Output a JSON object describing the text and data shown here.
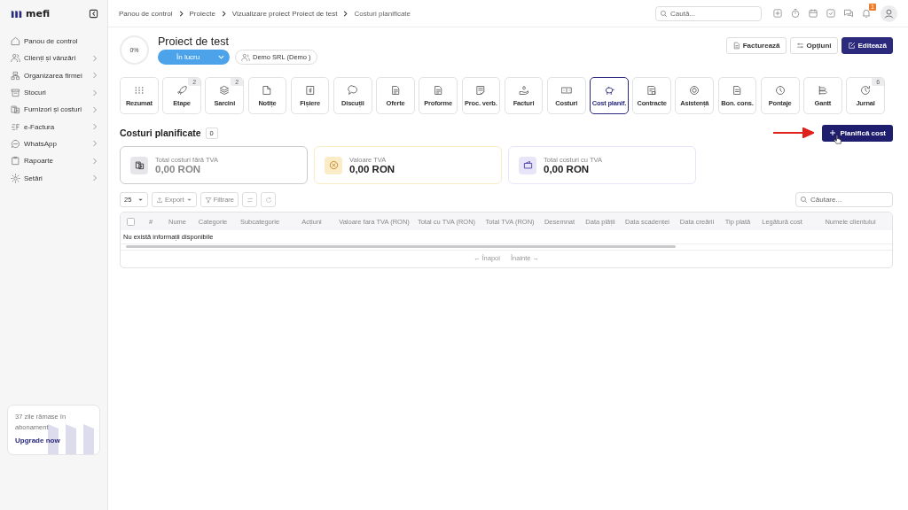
{
  "sidebar": {
    "logo": "mefi",
    "items": [
      {
        "label": "Panou de control",
        "expandable": false
      },
      {
        "label": "Clienți și vânzări",
        "expandable": true
      },
      {
        "label": "Organizarea firmei",
        "expandable": true
      },
      {
        "label": "Stocuri",
        "expandable": true
      },
      {
        "label": "Furnizori și costuri",
        "expandable": true
      },
      {
        "label": "e-Factura",
        "expandable": true
      },
      {
        "label": "WhatsApp",
        "expandable": true
      },
      {
        "label": "Rapoarte",
        "expandable": true
      },
      {
        "label": "Setări",
        "expandable": true
      }
    ],
    "subscription": {
      "text": "37 zile rămase în abonament",
      "link": "Upgrade now"
    }
  },
  "breadcrumb": [
    "Panou de control",
    "Proiecte",
    "Vizualizare proiect Proiect de test",
    "Costuri planificate"
  ],
  "search": {
    "placeholder": "Caută..."
  },
  "notifications": {
    "badge": "1"
  },
  "project": {
    "progress": "0%",
    "title": "Proiect de test",
    "status": "În lucru",
    "client": "Demo SRL (Demo )"
  },
  "actions": [
    {
      "label": "Facturează",
      "kind": "plain"
    },
    {
      "label": "Opțiuni",
      "kind": "plain"
    },
    {
      "label": "Editează",
      "kind": "primary"
    }
  ],
  "tabs": [
    {
      "label": "Rezumat",
      "selected": false
    },
    {
      "label": "Etape",
      "badge": "2",
      "selected": false
    },
    {
      "label": "Sarcini",
      "badge": "2",
      "selected": false
    },
    {
      "label": "Notițe",
      "selected": false
    },
    {
      "label": "Fișiere",
      "selected": false
    },
    {
      "label": "Discuții",
      "selected": false
    },
    {
      "label": "Oferte",
      "selected": false
    },
    {
      "label": "Proforme",
      "selected": false
    },
    {
      "label": "Proc. verb.",
      "selected": false
    },
    {
      "label": "Facturi",
      "selected": false
    },
    {
      "label": "Costuri",
      "selected": false
    },
    {
      "label": "Cost planif.",
      "selected": true
    },
    {
      "label": "Contracte",
      "selected": false
    },
    {
      "label": "Asistență",
      "selected": false
    },
    {
      "label": "Bon. cons.",
      "selected": false
    },
    {
      "label": "Pontaje",
      "selected": false
    },
    {
      "label": "Gantt",
      "selected": false
    },
    {
      "label": "Jurnal",
      "badge": "6",
      "selected": false
    }
  ],
  "section": {
    "title": "Costuri planificate",
    "count": "0",
    "add_button": "Planifică cost"
  },
  "stats": [
    {
      "label": "Total costuri fără TVA",
      "value": "0,00 RON",
      "color": "#e6e6ea",
      "muted": true
    },
    {
      "label": "Valoare TVA",
      "value": "0,00 RON",
      "color": "#fbecc8",
      "muted": false
    },
    {
      "label": "Total costuri cu TVA",
      "value": "0,00 RON",
      "color": "#e7e5f7",
      "muted": false
    }
  ],
  "toolbar": {
    "page_size": "25",
    "export": "Export",
    "filter": "Filtrare",
    "search_placeholder": "Căutare..."
  },
  "table": {
    "select_all_checked": false,
    "columns": [
      "#",
      "Nume",
      "Categorie",
      "Subcategorie",
      "Acțiuni",
      "Valoare fara TVA (RON)",
      "Total cu TVA (RON)",
      "Total TVA (RON)",
      "Desemnat",
      "Data plății",
      "Data scadenței",
      "Data creării",
      "Tip plată",
      "Legătură cost",
      "Numele clientului"
    ],
    "empty": "Nu există informații disponibile"
  },
  "pagination": {
    "prev": "← Înapoi",
    "next": "Înainte →"
  }
}
